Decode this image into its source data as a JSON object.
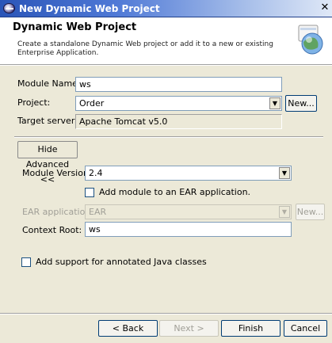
{
  "window": {
    "title": "New Dynamic Web Project"
  },
  "header": {
    "title": "Dynamic Web Project",
    "description": "Create a standalone Dynamic Web project or add it to a new or existing Enterprise Application."
  },
  "form": {
    "module_name_label": "Module Name:",
    "module_name_value": "ws",
    "project_label": "Project:",
    "project_value": "Order",
    "new_button": "New...",
    "target_server_label": "Target server:",
    "target_server_value": "Apache Tomcat v5.0"
  },
  "advanced": {
    "toggle_label": "Hide Advanced <<",
    "module_version_label": "Module Version:",
    "module_version_value": "2.4",
    "add_to_ear_label": "Add module to an EAR application.",
    "ear_application_label": "EAR application:",
    "ear_application_value": "EAR",
    "ear_new_button": "New...",
    "context_root_label": "Context Root:",
    "context_root_value": "ws"
  },
  "annotated_support_label": "Add support for annotated Java classes",
  "footer": {
    "back": "< Back",
    "next": "Next >",
    "finish": "Finish",
    "cancel": "Cancel"
  },
  "icons": {
    "window": "eclipse-icon",
    "close": "close-icon",
    "wizard": "globe-web-icon",
    "dropdown": "chevron-down-icon"
  },
  "colors": {
    "titlebar": "#2a55b8",
    "dialog_bg": "#ece9d8",
    "field_border": "#7f9db9"
  }
}
